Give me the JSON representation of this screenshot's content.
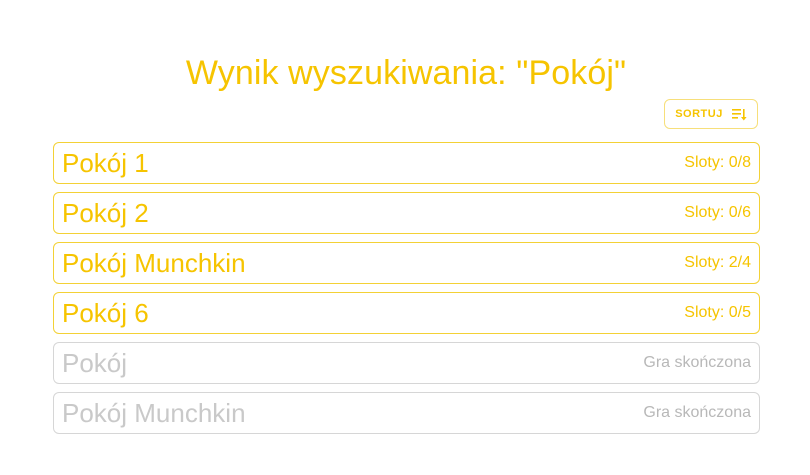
{
  "page_title": "Wynik wyszukiwania: \"Pokój\"",
  "sort_button": {
    "label": "SORTUJ",
    "icon": "sort-icon"
  },
  "rooms": [
    {
      "name": "Pokój 1",
      "status": "Sloty: 0/8",
      "state": "open"
    },
    {
      "name": "Pokój 2",
      "status": "Sloty: 0/6",
      "state": "open"
    },
    {
      "name": "Pokój Munchkin",
      "status": "Sloty: 2/4",
      "state": "open"
    },
    {
      "name": "Pokój 6",
      "status": "Sloty: 0/5",
      "state": "open"
    },
    {
      "name": "Pokój",
      "status": "Gra skończona",
      "state": "finished"
    },
    {
      "name": "Pokój Munchkin",
      "status": "Gra skończona",
      "state": "finished"
    }
  ],
  "colors": {
    "accent": "#f6c400",
    "disabled_text": "#c9c9c9",
    "disabled_border": "#d6d6d6"
  }
}
